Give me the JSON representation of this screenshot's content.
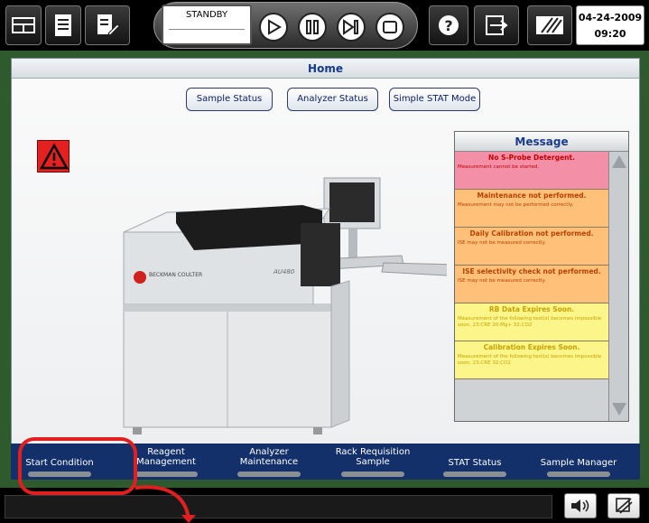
{
  "toolbar": {
    "left_icons": [
      "system-overview-icon",
      "list-icon",
      "edit-icon"
    ],
    "status": "STANDBY",
    "control_icons": [
      "play-icon",
      "pause-icon",
      "step-icon",
      "stop-icon"
    ],
    "right_icons": [
      "help-icon",
      "logout-icon",
      "monitor-icon"
    ],
    "date": "04-24-2009",
    "time": "09:20"
  },
  "page": {
    "title": "Home",
    "buttons": [
      "Sample Status",
      "Analyzer Status",
      "Simple STAT Mode"
    ]
  },
  "machine": {
    "brand": "BECKMAN COULTER",
    "model": "AU480"
  },
  "messages": {
    "title": "Message",
    "items": [
      {
        "title": "No S-Probe Detergent.",
        "detail": "Measurement cannot be started.",
        "bg": "#f48fa8",
        "color": "#c00000"
      },
      {
        "title": "Maintenance not performed.",
        "detail": "Measurement may not be performed correctly.",
        "bg": "#ffc07a",
        "color": "#b84000"
      },
      {
        "title": "Daily Calibration not performed.",
        "detail": "ISE may not be measured correctly.",
        "bg": "#ffc07a",
        "color": "#b84000"
      },
      {
        "title": "ISE selectivity check not performed.",
        "detail": "ISE may not be measured correctly.",
        "bg": "#ffc07a",
        "color": "#b84000"
      },
      {
        "title": "RB Data Expires Soon.",
        "detail": "Measurement of the following test(s) becomes impossible soon.  23:CRE 20:Mg+ 32:CO2",
        "bg": "#fbf58a",
        "color": "#c8a000"
      },
      {
        "title": "Calibration Expires Soon.",
        "detail": "Measurement of the following test(s) becomes impossible soon.  23:CRE 32:CO2",
        "bg": "#fbf58a",
        "color": "#c8a000"
      }
    ]
  },
  "nav": [
    "Start Condition",
    "Reagent Management",
    "Analyzer Maintenance",
    "Rack Requisition Sample",
    "STAT Status",
    "Sample Manager"
  ],
  "bottom_icons": [
    "sound-icon",
    "printer-icon"
  ]
}
